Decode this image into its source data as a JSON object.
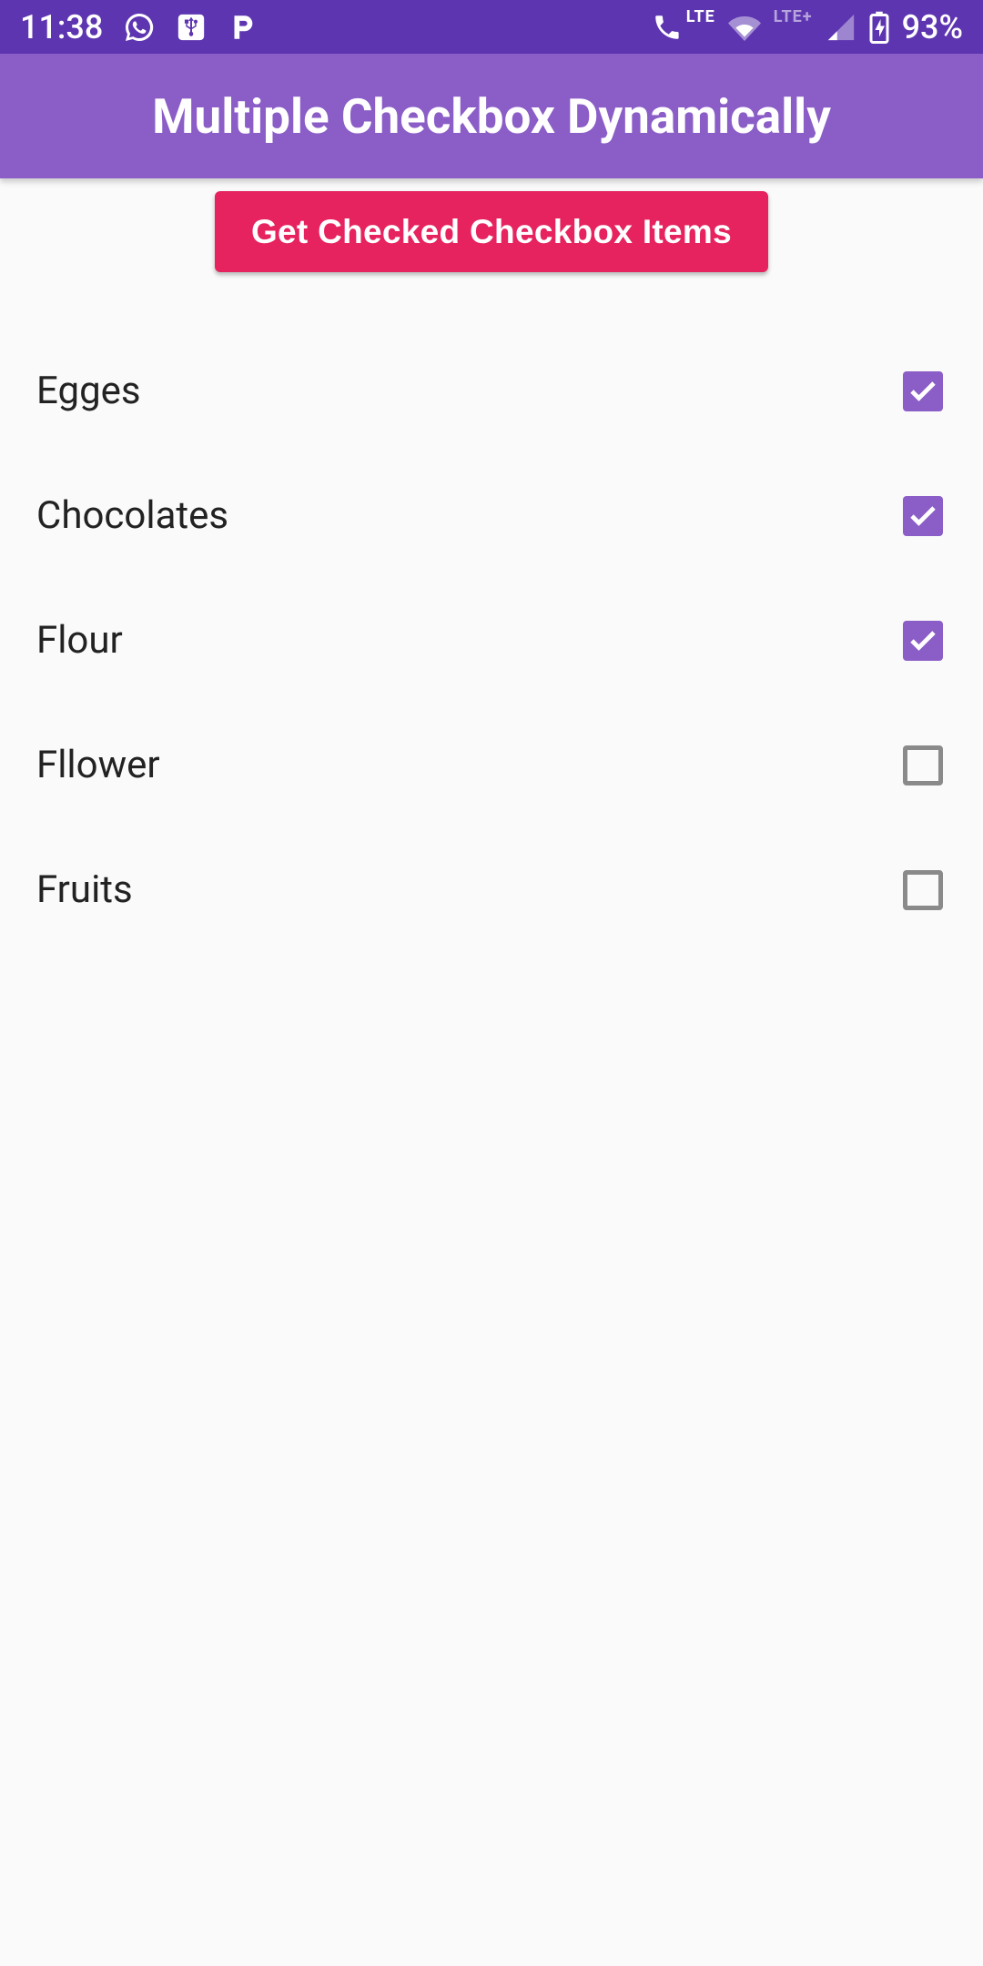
{
  "statusBar": {
    "time": "11:38",
    "batteryPercent": "93%",
    "networkLabel1": "LTE",
    "networkLabel2": "LTE+"
  },
  "appBar": {
    "title": "Multiple Checkbox Dynamically"
  },
  "button": {
    "label": "Get Checked Checkbox Items"
  },
  "items": [
    {
      "label": "Egges",
      "checked": true
    },
    {
      "label": "Chocolates",
      "checked": true
    },
    {
      "label": "Flour",
      "checked": true
    },
    {
      "label": "Fllower",
      "checked": false
    },
    {
      "label": "Fruits",
      "checked": false
    }
  ],
  "colors": {
    "statusBarBg": "#5e35b1",
    "appBarBg": "#8b5dc7",
    "buttonBg": "#e6235f",
    "checkboxChecked": "#8b5dc7"
  }
}
